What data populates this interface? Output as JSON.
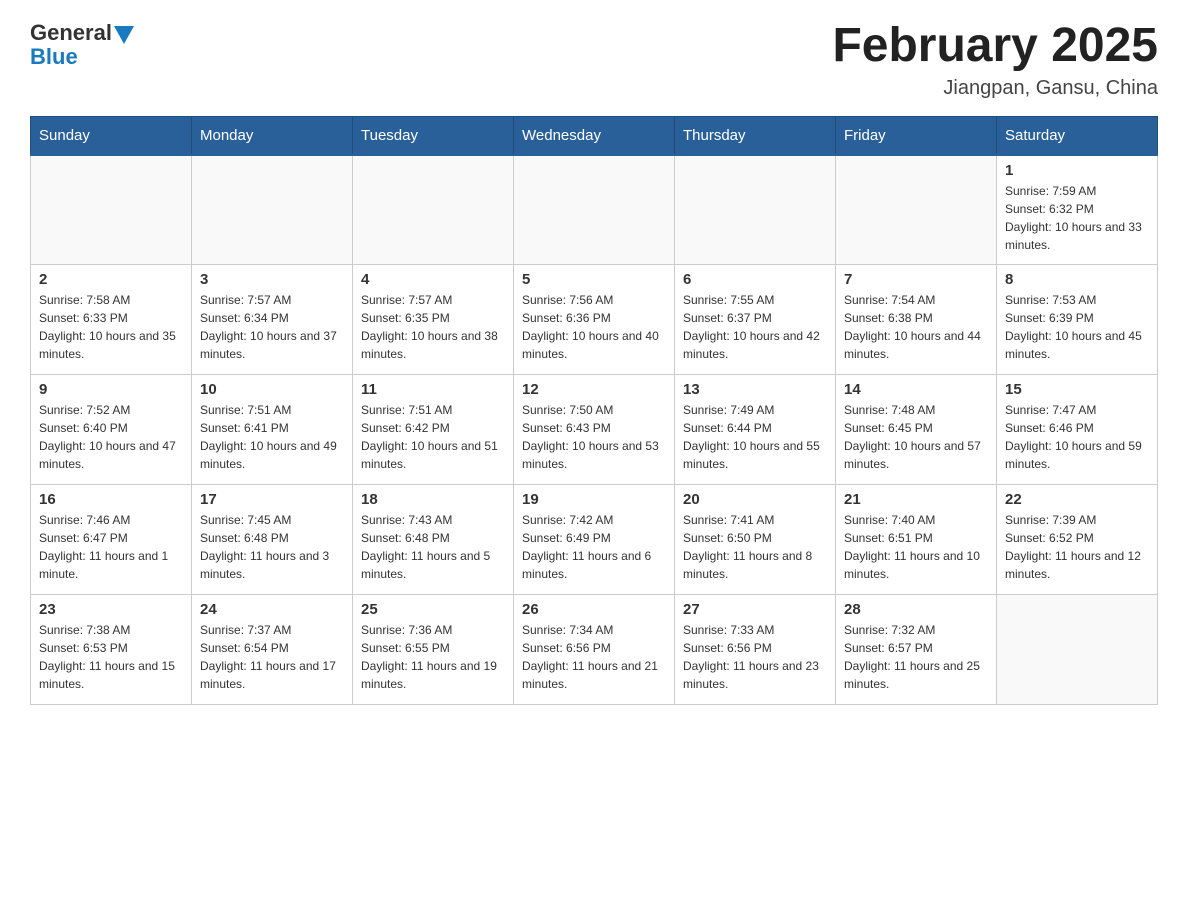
{
  "header": {
    "logo_general": "General",
    "logo_blue": "Blue",
    "title": "February 2025",
    "subtitle": "Jiangpan, Gansu, China"
  },
  "days_of_week": [
    "Sunday",
    "Monday",
    "Tuesday",
    "Wednesday",
    "Thursday",
    "Friday",
    "Saturday"
  ],
  "weeks": [
    [
      {
        "day": "",
        "info": ""
      },
      {
        "day": "",
        "info": ""
      },
      {
        "day": "",
        "info": ""
      },
      {
        "day": "",
        "info": ""
      },
      {
        "day": "",
        "info": ""
      },
      {
        "day": "",
        "info": ""
      },
      {
        "day": "1",
        "info": "Sunrise: 7:59 AM\nSunset: 6:32 PM\nDaylight: 10 hours and 33 minutes."
      }
    ],
    [
      {
        "day": "2",
        "info": "Sunrise: 7:58 AM\nSunset: 6:33 PM\nDaylight: 10 hours and 35 minutes."
      },
      {
        "day": "3",
        "info": "Sunrise: 7:57 AM\nSunset: 6:34 PM\nDaylight: 10 hours and 37 minutes."
      },
      {
        "day": "4",
        "info": "Sunrise: 7:57 AM\nSunset: 6:35 PM\nDaylight: 10 hours and 38 minutes."
      },
      {
        "day": "5",
        "info": "Sunrise: 7:56 AM\nSunset: 6:36 PM\nDaylight: 10 hours and 40 minutes."
      },
      {
        "day": "6",
        "info": "Sunrise: 7:55 AM\nSunset: 6:37 PM\nDaylight: 10 hours and 42 minutes."
      },
      {
        "day": "7",
        "info": "Sunrise: 7:54 AM\nSunset: 6:38 PM\nDaylight: 10 hours and 44 minutes."
      },
      {
        "day": "8",
        "info": "Sunrise: 7:53 AM\nSunset: 6:39 PM\nDaylight: 10 hours and 45 minutes."
      }
    ],
    [
      {
        "day": "9",
        "info": "Sunrise: 7:52 AM\nSunset: 6:40 PM\nDaylight: 10 hours and 47 minutes."
      },
      {
        "day": "10",
        "info": "Sunrise: 7:51 AM\nSunset: 6:41 PM\nDaylight: 10 hours and 49 minutes."
      },
      {
        "day": "11",
        "info": "Sunrise: 7:51 AM\nSunset: 6:42 PM\nDaylight: 10 hours and 51 minutes."
      },
      {
        "day": "12",
        "info": "Sunrise: 7:50 AM\nSunset: 6:43 PM\nDaylight: 10 hours and 53 minutes."
      },
      {
        "day": "13",
        "info": "Sunrise: 7:49 AM\nSunset: 6:44 PM\nDaylight: 10 hours and 55 minutes."
      },
      {
        "day": "14",
        "info": "Sunrise: 7:48 AM\nSunset: 6:45 PM\nDaylight: 10 hours and 57 minutes."
      },
      {
        "day": "15",
        "info": "Sunrise: 7:47 AM\nSunset: 6:46 PM\nDaylight: 10 hours and 59 minutes."
      }
    ],
    [
      {
        "day": "16",
        "info": "Sunrise: 7:46 AM\nSunset: 6:47 PM\nDaylight: 11 hours and 1 minute."
      },
      {
        "day": "17",
        "info": "Sunrise: 7:45 AM\nSunset: 6:48 PM\nDaylight: 11 hours and 3 minutes."
      },
      {
        "day": "18",
        "info": "Sunrise: 7:43 AM\nSunset: 6:48 PM\nDaylight: 11 hours and 5 minutes."
      },
      {
        "day": "19",
        "info": "Sunrise: 7:42 AM\nSunset: 6:49 PM\nDaylight: 11 hours and 6 minutes."
      },
      {
        "day": "20",
        "info": "Sunrise: 7:41 AM\nSunset: 6:50 PM\nDaylight: 11 hours and 8 minutes."
      },
      {
        "day": "21",
        "info": "Sunrise: 7:40 AM\nSunset: 6:51 PM\nDaylight: 11 hours and 10 minutes."
      },
      {
        "day": "22",
        "info": "Sunrise: 7:39 AM\nSunset: 6:52 PM\nDaylight: 11 hours and 12 minutes."
      }
    ],
    [
      {
        "day": "23",
        "info": "Sunrise: 7:38 AM\nSunset: 6:53 PM\nDaylight: 11 hours and 15 minutes."
      },
      {
        "day": "24",
        "info": "Sunrise: 7:37 AM\nSunset: 6:54 PM\nDaylight: 11 hours and 17 minutes."
      },
      {
        "day": "25",
        "info": "Sunrise: 7:36 AM\nSunset: 6:55 PM\nDaylight: 11 hours and 19 minutes."
      },
      {
        "day": "26",
        "info": "Sunrise: 7:34 AM\nSunset: 6:56 PM\nDaylight: 11 hours and 21 minutes."
      },
      {
        "day": "27",
        "info": "Sunrise: 7:33 AM\nSunset: 6:56 PM\nDaylight: 11 hours and 23 minutes."
      },
      {
        "day": "28",
        "info": "Sunrise: 7:32 AM\nSunset: 6:57 PM\nDaylight: 11 hours and 25 minutes."
      },
      {
        "day": "",
        "info": ""
      }
    ]
  ]
}
